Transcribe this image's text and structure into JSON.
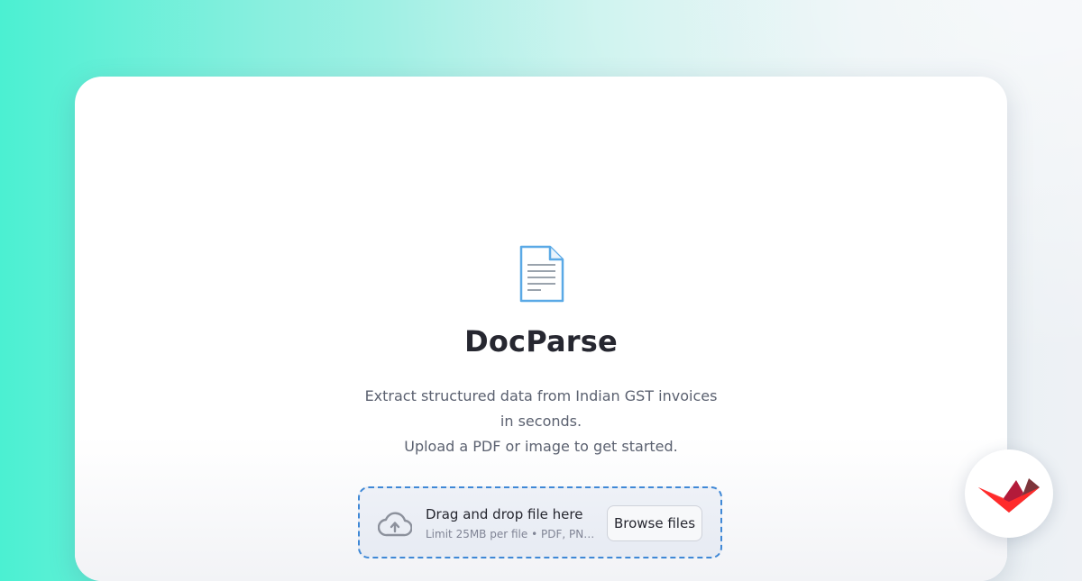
{
  "app": {
    "title": "DocParse",
    "subtitle_line1": "Extract structured data from Indian GST invoices in seconds.",
    "subtitle_line2": "Upload a PDF or image to get started."
  },
  "uploader": {
    "drag_text": "Drag and drop file here",
    "limit_text": "Limit 25MB per file • PDF, PNG…",
    "browse_label": "Browse files",
    "border_color": "#3f88d6"
  },
  "icons": {
    "header": "document-icon",
    "upload": "cloud-upload-icon",
    "badge": "streamlit-logo-icon"
  },
  "colors": {
    "accent": "#3f88d6",
    "logo_red": "#ff2b2b",
    "background_teal": "#4bf0d2"
  }
}
